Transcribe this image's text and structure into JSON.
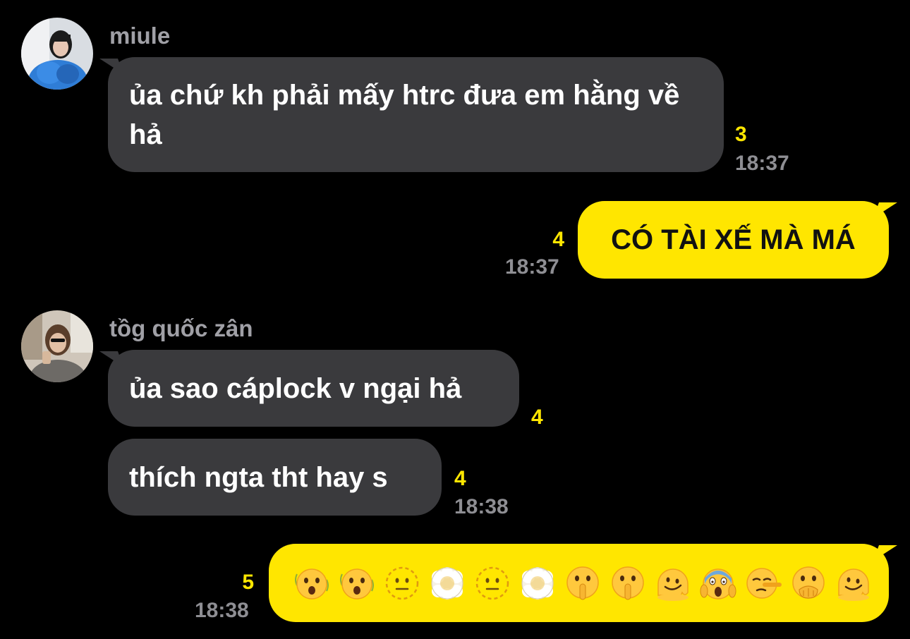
{
  "colors": {
    "background": "#000000",
    "incoming_bubble": "#3a3a3d",
    "outgoing_bubble": "#ffe600",
    "unread_count": "#ffe600",
    "timestamp": "#8e8e93",
    "sender_name": "#a0a0a6"
  },
  "messages": [
    {
      "sender": "miule",
      "direction": "incoming",
      "text": "ủa chứ kh phải mấy htrc đưa em hằng về hả",
      "unread": "3",
      "time": "18:37"
    },
    {
      "direction": "outgoing",
      "text": "CÓ TÀI XẾ MÀ MÁ",
      "unread": "4",
      "time": "18:37"
    },
    {
      "sender": "tồg quốc zân",
      "direction": "incoming",
      "text": "ủa sao cáplock v ngại hả",
      "unread": "4"
    },
    {
      "direction": "incoming",
      "text": "thích ngta tht hay s",
      "unread": "4",
      "time": "18:38"
    },
    {
      "direction": "outgoing",
      "emojis": [
        "face-with-open-mouth-shaking-emoji",
        "face-with-open-mouth-shaking-emoji",
        "dotted-line-face-emoji",
        "face-in-clouds-emoji",
        "dotted-line-face-emoji",
        "face-in-clouds-emoji",
        "shushing-face-emoji",
        "shushing-face-emoji",
        "melting-face-emoji",
        "face-screaming-in-fear-emoji",
        "lying-face-emoji",
        "face-with-hand-over-mouth-emoji",
        "melting-face-emoji"
      ],
      "unread": "5",
      "time": "18:38"
    }
  ]
}
